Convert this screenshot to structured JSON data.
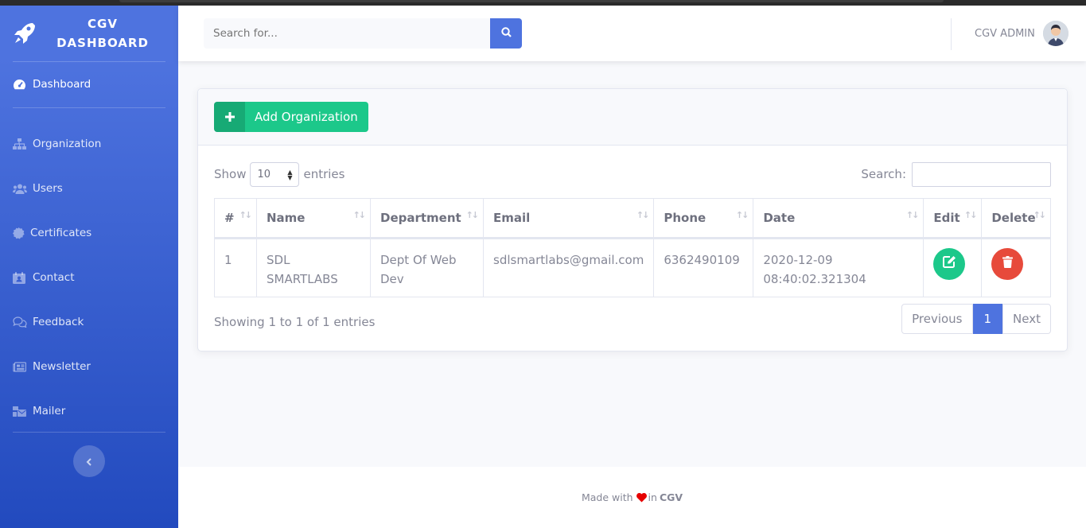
{
  "brand": {
    "line1": "CGV",
    "line2": "DASHBOARD"
  },
  "sidebar": {
    "dashboard": "Dashboard",
    "items": [
      {
        "label": "Organization",
        "icon": "sitemap-icon"
      },
      {
        "label": "Users",
        "icon": "users-icon"
      },
      {
        "label": "Certificates",
        "icon": "certificate-icon"
      },
      {
        "label": "Contact",
        "icon": "address-card-icon"
      },
      {
        "label": "Feedback",
        "icon": "comments-icon"
      },
      {
        "label": "Newsletter",
        "icon": "newspaper-icon"
      },
      {
        "label": "Mailer",
        "icon": "mail-bulk-icon"
      }
    ]
  },
  "topbar": {
    "search_placeholder": "Search for...",
    "user_name": "CGV ADMIN"
  },
  "card": {
    "add_button": "Add Organization"
  },
  "table_controls": {
    "show": "Show",
    "entries_value": "10",
    "entries": "entries",
    "search_label": "Search:"
  },
  "table": {
    "headers": [
      "#",
      "Name",
      "Department",
      "Email",
      "Phone",
      "Date",
      "Edit",
      "Delete"
    ],
    "rows": [
      {
        "num": "1",
        "name": "SDL SMARTLABS",
        "department": "Dept Of Web Dev",
        "email": "sdlsmartlabs@gmail.com",
        "phone": "6362490109",
        "date": "2020-12-09 08:40:02.321304"
      }
    ]
  },
  "pagination": {
    "info": "Showing 1 to 1 of 1 entries",
    "previous": "Previous",
    "current": "1",
    "next": "Next"
  },
  "footer": {
    "made_with": "Made with",
    "in": "in",
    "brand": "CGV"
  },
  "colors": {
    "primary": "#4e73df",
    "success": "#1cc88a",
    "danger": "#e74a3b"
  }
}
